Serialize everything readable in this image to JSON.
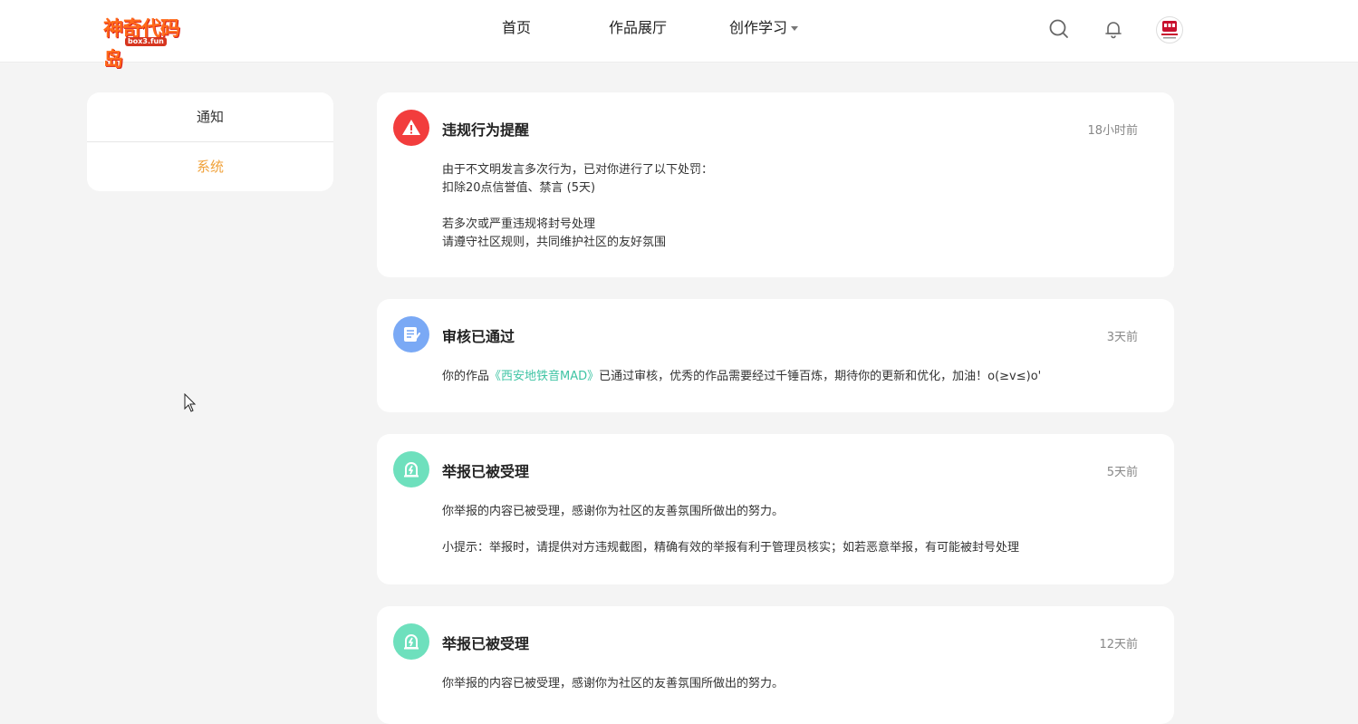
{
  "header": {
    "logo_text": "神奇代码岛",
    "logo_sub": "box3.fun",
    "nav": {
      "home": "首页",
      "gallery": "作品展厅",
      "learn": "创作学习"
    },
    "icons": {
      "search": "search-icon",
      "bell": "bell-icon",
      "avatar": "avatar"
    }
  },
  "sidebar": {
    "items": [
      {
        "label": "通知"
      },
      {
        "label": "系统"
      }
    ]
  },
  "messages": [
    {
      "icon": "warning-icon",
      "icon_color": "#f23d3d",
      "title": "违规行为提醒",
      "time": "18小时前",
      "lines": [
        "由于不文明发言多次行为，已对你进行了以下处罚：",
        "扣除20点信誉值、禁言 (5天)",
        "若多次或严重违规将封号处理",
        "请遵守社区规则，共同维护社区的友好氛围"
      ]
    },
    {
      "icon": "document-icon",
      "icon_color": "#7aa9f5",
      "title": "审核已通过",
      "time": "3天前",
      "text_before": "你的作品",
      "work_link": "《西安地铁音MAD》",
      "text_after": "已通过审核，优秀的作品需要经过千锤百炼，期待你的更新和优化，加油！o(≥v≤)o'"
    },
    {
      "icon": "report-icon",
      "icon_color": "#6ee0bd",
      "title": "举报已被受理",
      "time": "5天前",
      "lines": [
        "你举报的内容已被受理，感谢你为社区的友善氛围所做出的努力。",
        "小提示：举报时，请提供对方违规截图，精确有效的举报有利于管理员核实；如若恶意举报，有可能被封号处理"
      ]
    },
    {
      "icon": "report-icon",
      "icon_color": "#6ee0bd",
      "title": "举报已被受理",
      "time": "12天前",
      "lines": [
        "你举报的内容已被受理，感谢你为社区的友善氛围所做出的努力。"
      ]
    }
  ]
}
